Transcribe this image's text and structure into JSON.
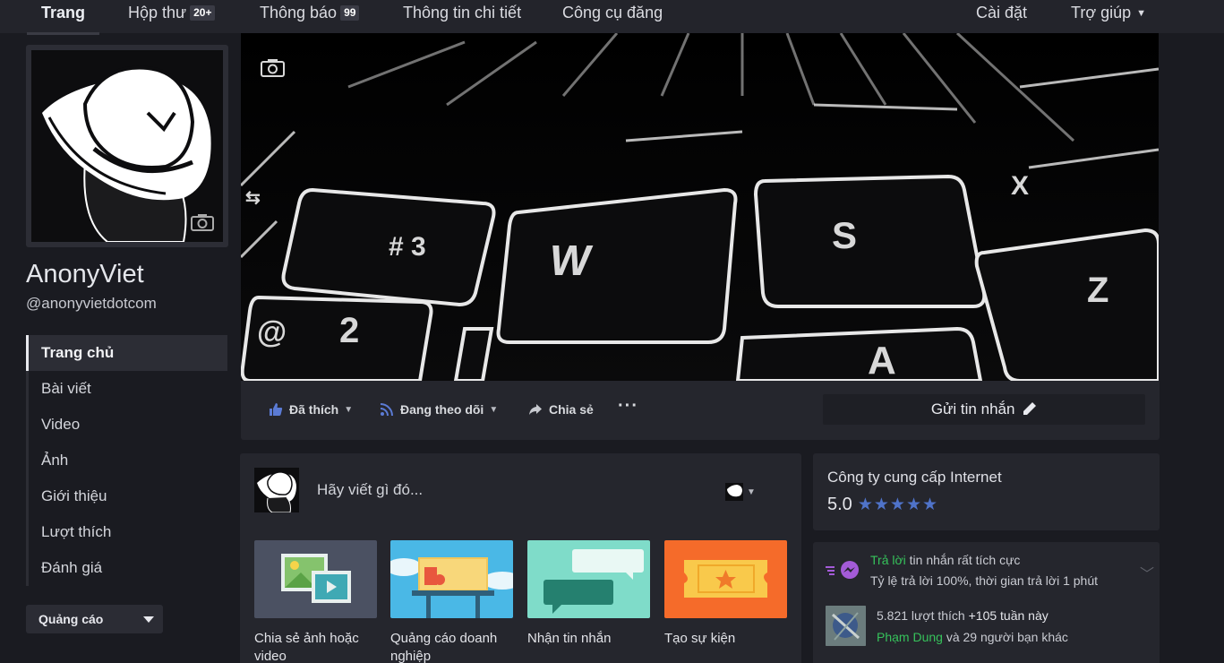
{
  "nav": {
    "home": "Trang",
    "inbox": "Hộp thư",
    "inbox_badge": "20+",
    "notifications": "Thông báo",
    "notifications_badge": "99",
    "insights": "Thông tin chi tiết",
    "publishing_tools": "Công cụ đăng",
    "settings": "Cài đặt",
    "help": "Trợ giúp"
  },
  "profile": {
    "name": "AnonyViet",
    "handle": "@anonyvietdotcom"
  },
  "sidebar": {
    "items": [
      {
        "label": "Trang chủ"
      },
      {
        "label": "Bài viết"
      },
      {
        "label": "Video"
      },
      {
        "label": "Ảnh"
      },
      {
        "label": "Giới thiệu"
      },
      {
        "label": "Lượt thích"
      },
      {
        "label": "Đánh giá"
      }
    ],
    "ads_button": "Quảng cáo"
  },
  "actions": {
    "liked": "Đã thích",
    "following": "Đang theo dõi",
    "share": "Chia sẻ",
    "more": "···",
    "send_message": "Gửi tin nhắn"
  },
  "composer": {
    "prompt": "Hãy viết gì đó...",
    "cards": [
      {
        "label": "Chia sẻ ảnh hoặc video"
      },
      {
        "label": "Quảng cáo doanh nghiệp"
      },
      {
        "label": "Nhận tin nhắn"
      },
      {
        "label": "Tạo sự kiện"
      }
    ]
  },
  "about": {
    "category": "Công ty cung cấp Internet",
    "rating": "5.0",
    "stars": 5,
    "star_color": "#4f73c9"
  },
  "stats": {
    "response_highlight": "Trả lời",
    "response_rest": " tin nhắn rất tích cực",
    "response_detail": "Tỷ lệ trả lời 100%, thời gian trả lời 1 phút",
    "likes_count": "5.821 lượt thích",
    "likes_week": "+105 tuần này",
    "friend_name": "Phạm Dung",
    "friends_rest": " và 29 người bạn khác"
  },
  "colors": {
    "background": "#1a1b21",
    "panel": "#25262d",
    "accent_green": "#36c25b",
    "accent_blue": "#4f73c9"
  }
}
